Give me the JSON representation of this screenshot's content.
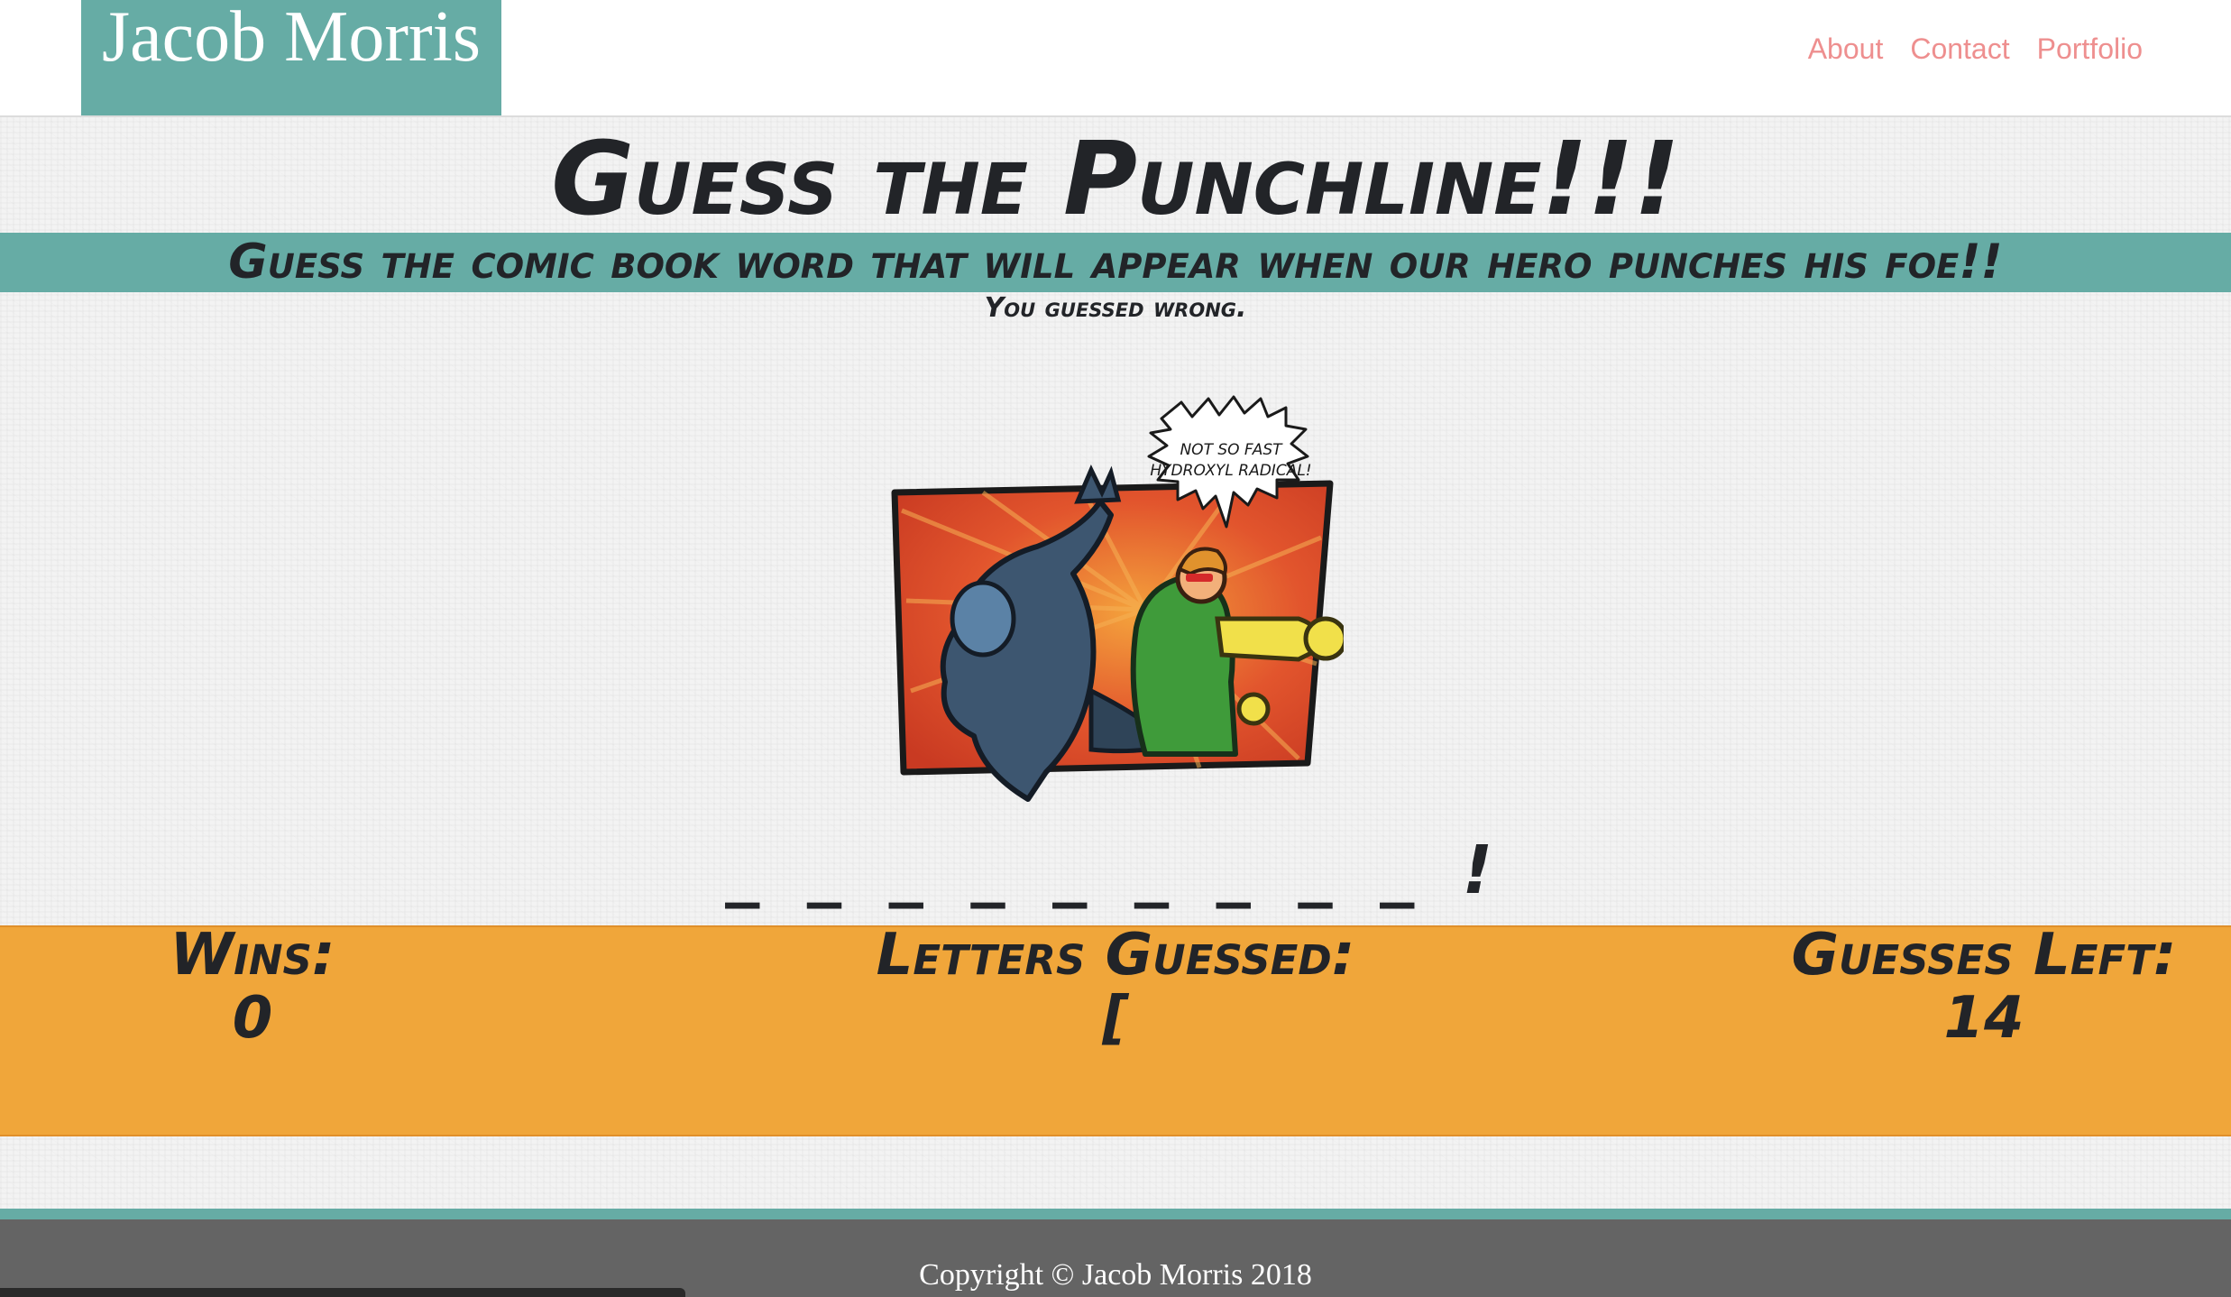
{
  "header": {
    "brand": "Jacob Morris",
    "nav": [
      {
        "label": "About"
      },
      {
        "label": "Contact"
      },
      {
        "label": "Portfolio"
      }
    ],
    "colors": {
      "brand_bg": "#66aca5",
      "nav_link": "#ee8f8f"
    }
  },
  "game": {
    "title": "Guess the Punchline!!!",
    "subtitle": "Guess the comic book word that will appear when our hero punches his foe!!",
    "feedback": "You guessed wrong.",
    "speech_bubble": [
      "NOT SO FAST",
      "HYDROXYL RADICAL!"
    ],
    "word_display": "_ _ _ _ _ _ _ _ _ !"
  },
  "stats": {
    "wins_label": "Wins:",
    "wins_value": "0",
    "letters_label": "Letters Guessed:",
    "letters_value": "[",
    "guesses_label": "Guesses Left:",
    "guesses_value": "14"
  },
  "footer": {
    "copyright": "Copyright © Jacob Morris 2018"
  },
  "colors": {
    "accent_teal": "#66aca5",
    "score_orange": "#f0a63a",
    "footer_gray": "#646464"
  }
}
